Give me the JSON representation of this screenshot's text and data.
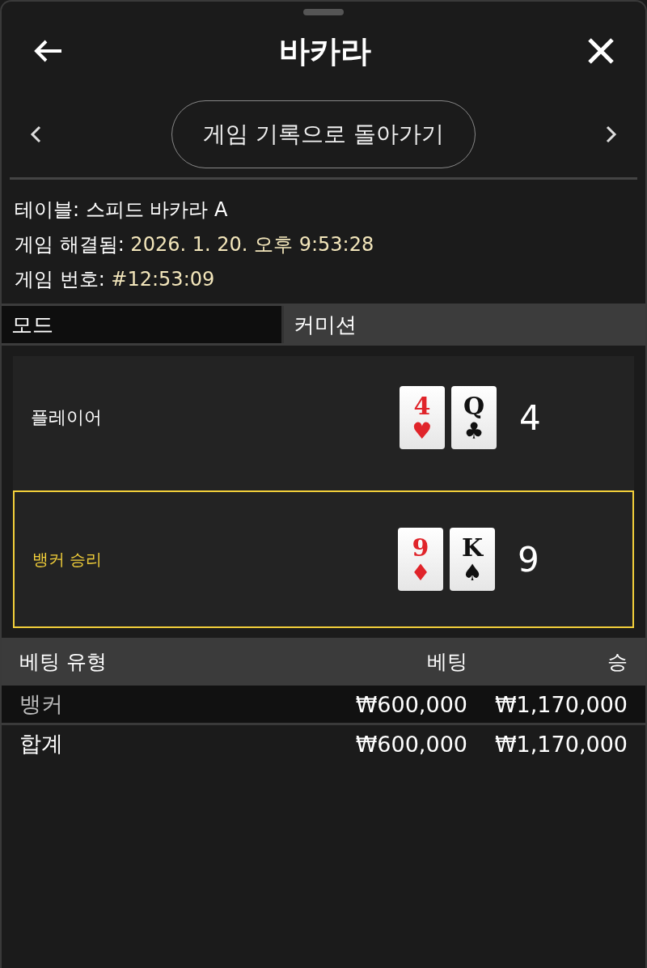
{
  "header": {
    "title": "바카라"
  },
  "navigation": {
    "back_to_history": "게임 기록으로 돌아가기"
  },
  "info": [
    {
      "label": "테이블:",
      "value": "스피드 바카라 A",
      "highlighted": false
    },
    {
      "label": "게임 해결됨:",
      "value": "2026. 1. 20. 오후 9:53:28",
      "highlighted": true
    },
    {
      "label": "게임 번호:",
      "value": "#12:53:09",
      "highlighted": true
    }
  ],
  "mode": {
    "label": "모드",
    "value": "커미션"
  },
  "hands": [
    {
      "name": "플레이어",
      "winner": false,
      "score": "4",
      "cards": [
        {
          "rank": "4",
          "suit": "♥",
          "color": "#e0242a"
        },
        {
          "rank": "Q",
          "suit": "♣",
          "color": "#111111"
        }
      ]
    },
    {
      "name": "뱅커 승리",
      "winner": true,
      "score": "9",
      "cards": [
        {
          "rank": "9",
          "suit": "♦",
          "color": "#e0242a"
        },
        {
          "rank": "K",
          "suit": "♠",
          "color": "#111111"
        }
      ]
    }
  ],
  "bets": {
    "columns": [
      "베팅 유형",
      "베팅",
      "승"
    ],
    "rows": [
      {
        "type": "뱅커",
        "bet": "₩600,000",
        "win": "₩1,170,000"
      }
    ],
    "total": {
      "type": "합계",
      "bet": "₩600,000",
      "win": "₩1,170,000"
    }
  }
}
